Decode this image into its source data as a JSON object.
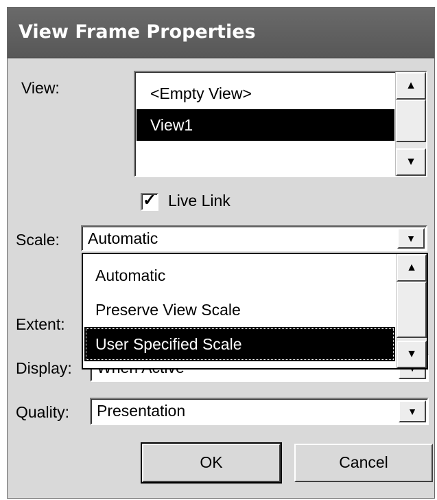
{
  "dialog": {
    "title": "View Frame Properties"
  },
  "view": {
    "label": "View:",
    "items": [
      "<Empty View>",
      "View1"
    ],
    "selected_index": 1
  },
  "live_link": {
    "label": "Live Link",
    "checked": true,
    "mark": "✓"
  },
  "scale": {
    "label": "Scale:",
    "value": "Automatic",
    "options": [
      "Automatic",
      "Preserve View Scale",
      "User Specified Scale"
    ],
    "highlighted_index": 2
  },
  "extent": {
    "label": "Extent:"
  },
  "display": {
    "label": "Display:",
    "value": "When Active"
  },
  "quality": {
    "label": "Quality:",
    "value": "Presentation"
  },
  "buttons": {
    "ok": "OK",
    "cancel": "Cancel"
  },
  "icons": {
    "scroll_up": "▲",
    "scroll_down": "▼"
  }
}
